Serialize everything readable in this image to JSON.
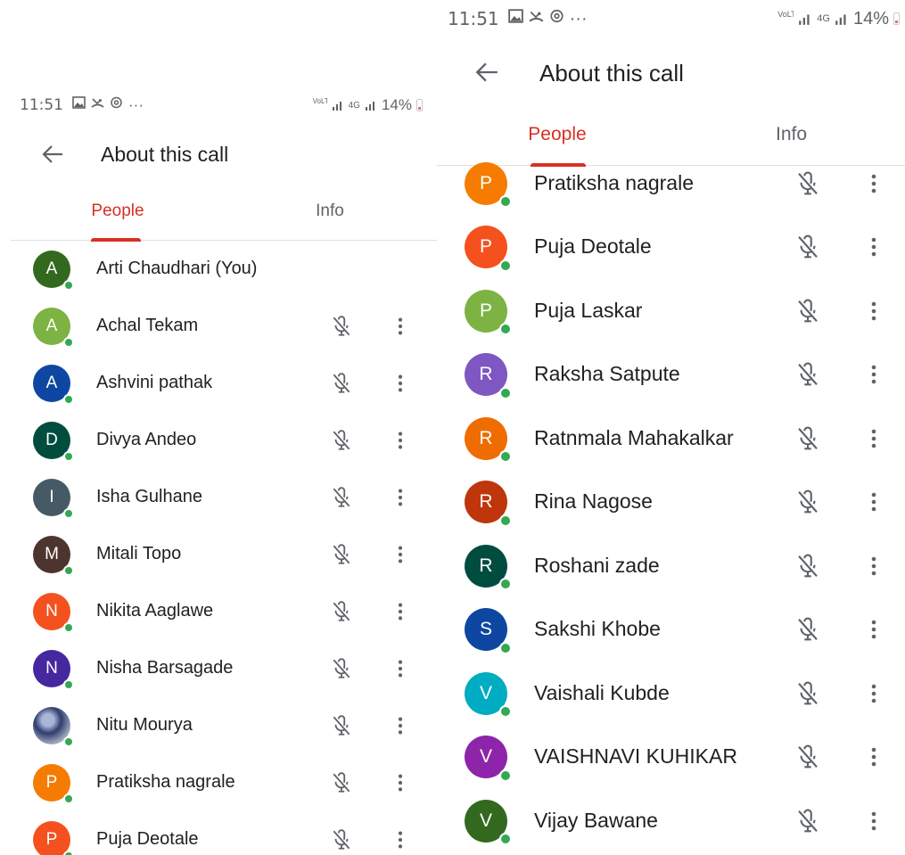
{
  "left": {
    "status": {
      "time": "11:51",
      "overflow": "···",
      "volte": "VoLTE",
      "network": "4G",
      "battery": "14%"
    },
    "header": {
      "title": "About this call"
    },
    "tabs": [
      {
        "label": "People",
        "active": true
      },
      {
        "label": "Info",
        "active": false
      }
    ],
    "participants": [
      {
        "initial": "A",
        "name": "Arti Chaudhari (You)",
        "color": "#33691e",
        "self": true
      },
      {
        "initial": "A",
        "name": "Achal Tekam",
        "color": "#7cb342"
      },
      {
        "initial": "A",
        "name": "Ashvini pathak",
        "color": "#0d47a1"
      },
      {
        "initial": "D",
        "name": "Divya Andeo",
        "color": "#004d40"
      },
      {
        "initial": "I",
        "name": "Isha Gulhane",
        "color": "#455a64"
      },
      {
        "initial": "M",
        "name": "Mitali Topo",
        "color": "#4e342e"
      },
      {
        "initial": "N",
        "name": "Nikita Aaglawe",
        "color": "#f4511e"
      },
      {
        "initial": "N",
        "name": "Nisha Barsagade",
        "color": "#4527a0"
      },
      {
        "initial": "",
        "name": "Nitu Mourya",
        "color": "#2f3c6e",
        "photo": true
      },
      {
        "initial": "P",
        "name": "Pratiksha nagrale",
        "color": "#f57c00"
      },
      {
        "initial": "P",
        "name": "Puja Deotale",
        "color": "#f4511e"
      }
    ]
  },
  "right": {
    "status": {
      "time": "11:51",
      "overflow": "···",
      "volte": "VoLTE",
      "network": "4G",
      "battery": "14%"
    },
    "header": {
      "title": "About this call"
    },
    "tabs": [
      {
        "label": "People",
        "active": true
      },
      {
        "label": "Info",
        "active": false
      }
    ],
    "participants": [
      {
        "initial": "P",
        "name": "Pratiksha nagrale",
        "color": "#f57c00"
      },
      {
        "initial": "P",
        "name": "Puja Deotale",
        "color": "#f4511e"
      },
      {
        "initial": "P",
        "name": "Puja Laskar",
        "color": "#7cb342"
      },
      {
        "initial": "R",
        "name": "Raksha Satpute",
        "color": "#7e57c2"
      },
      {
        "initial": "R",
        "name": "Ratnmala Mahakalkar",
        "color": "#ef6c00"
      },
      {
        "initial": "R",
        "name": "Rina Nagose",
        "color": "#bf360c"
      },
      {
        "initial": "R",
        "name": "Roshani zade",
        "color": "#004d40"
      },
      {
        "initial": "S",
        "name": "Sakshi Khobe",
        "color": "#0d47a1"
      },
      {
        "initial": "V",
        "name": "Vaishali Kubde",
        "color": "#00acc1"
      },
      {
        "initial": "V",
        "name": "VAISHNAVI KUHIKAR",
        "color": "#8e24aa"
      },
      {
        "initial": "V",
        "name": "Vijay Bawane",
        "color": "#33691e"
      }
    ]
  }
}
